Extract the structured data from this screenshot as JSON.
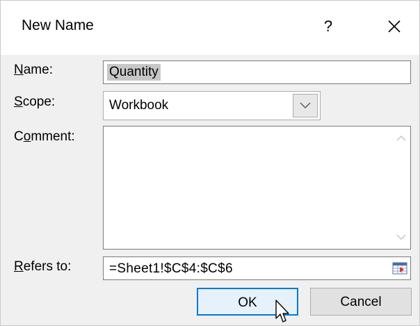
{
  "dialog": {
    "title": "New Name",
    "help_label": "?",
    "close_icon": "close-icon"
  },
  "fields": {
    "name": {
      "label_pre": "",
      "label_u": "N",
      "label_post": "ame:",
      "value": "Quantity"
    },
    "scope": {
      "label_pre": "",
      "label_u": "S",
      "label_post": "cope:",
      "value": "Workbook"
    },
    "comment": {
      "label_pre": "C",
      "label_u": "o",
      "label_post": "mment:",
      "value": ""
    },
    "refers_to": {
      "label_pre": "",
      "label_u": "R",
      "label_post": "efers to:",
      "value": "=Sheet1!$C$4:$C$6"
    }
  },
  "buttons": {
    "ok": "OK",
    "cancel": "Cancel"
  },
  "icons": {
    "scope_arrow": "chevron-down-icon",
    "scroll_up": "chevron-up-icon",
    "scroll_down": "chevron-down-icon",
    "collapse": "collapse-dialog-icon",
    "cursor": "mouse-pointer-icon"
  },
  "colors": {
    "ok_border": "#0078d7",
    "ok_bg": "#e5f1fb",
    "selection": "#c7c7c7"
  }
}
